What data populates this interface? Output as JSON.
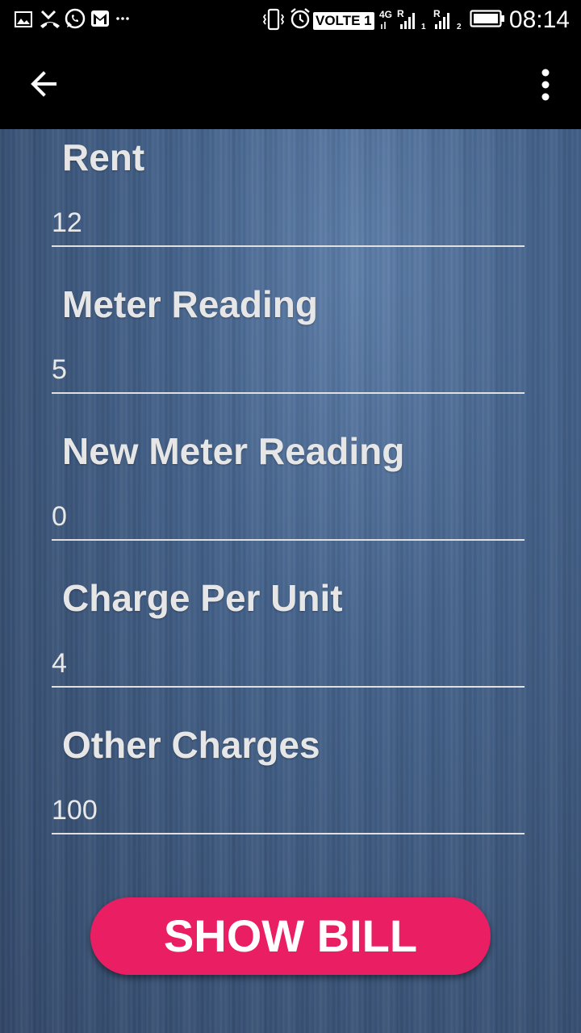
{
  "status_bar": {
    "time": "08:14",
    "volte": "VOLTE 1",
    "network_4g": "4G",
    "roaming_1": "R",
    "roaming_2": "R",
    "sim_1": "1",
    "sim_2": "2",
    "icons": [
      "image-icon",
      "missed-call-icon",
      "whatsapp-icon",
      "gmail-icon",
      "more-notifications-icon",
      "vibrate-icon",
      "alarm-icon",
      "signal-icon",
      "battery-icon"
    ]
  },
  "toolbar": {
    "back_icon": "back-arrow-icon",
    "menu_icon": "overflow-menu-icon"
  },
  "form": {
    "fields": [
      {
        "label": "Rent",
        "value": "12"
      },
      {
        "label": "Meter Reading",
        "value": "5"
      },
      {
        "label": "New Meter Reading",
        "value": "0"
      },
      {
        "label": "Charge Per Unit",
        "value": "4"
      },
      {
        "label": "Other Charges",
        "value": "100"
      }
    ],
    "submit_label": "SHOW BILL",
    "accent_color": "#e91e63"
  }
}
